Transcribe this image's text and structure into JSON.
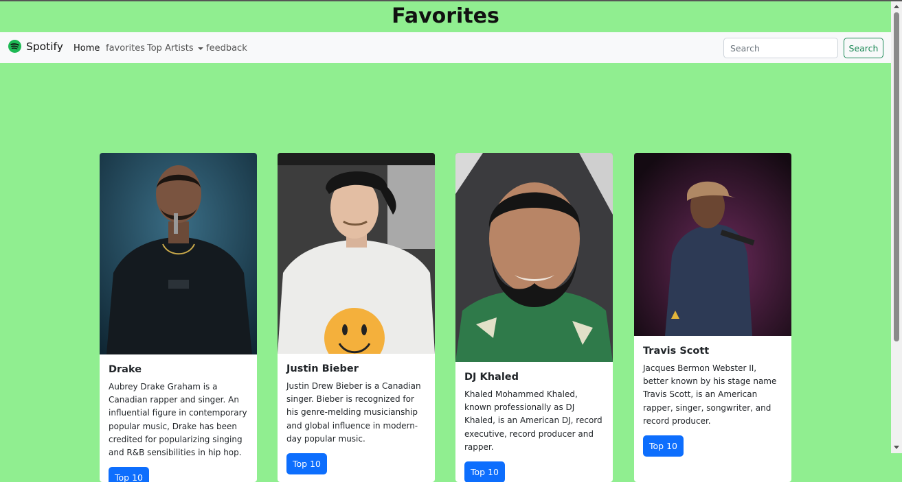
{
  "page": {
    "title": "Favorites",
    "background": "#90ee90"
  },
  "navbar": {
    "brand": "Spotify",
    "links": [
      {
        "label": "Home"
      },
      {
        "label": "favorites"
      },
      {
        "label": "Top Artists"
      },
      {
        "label": "feedback"
      }
    ],
    "search": {
      "placeholder": "Search",
      "value": "",
      "button_label": "Search"
    }
  },
  "cards": [
    {
      "name": "Drake",
      "description": "Aubrey Drake Graham is a Canadian rapper and singer. An influential figure in contemporary popular music, Drake has been credited for popularizing singing and R&B sensibilities in hip hop.",
      "button_label": "Top 10"
    },
    {
      "name": "Justin Bieber",
      "description": "Justin Drew Bieber is a Canadian singer. Bieber is recognized for his genre-melding musicianship and global influence in modern-day popular music.",
      "button_label": "Top 10"
    },
    {
      "name": "DJ Khaled",
      "description": "Khaled Mohammed Khaled, known professionally as DJ Khaled, is an American DJ, record executive, record producer and rapper.",
      "button_label": "Top 10"
    },
    {
      "name": "Travis Scott",
      "description": "Jacques Bermon Webster II, better known by his stage name Travis Scott, is an American rapper, singer, songwriter, and record producer.",
      "button_label": "Top 10"
    }
  ],
  "colors": {
    "primary": "#0d6efd",
    "success": "#198754",
    "navbar_bg": "#f8f9fa",
    "spotify": "#1db954"
  }
}
